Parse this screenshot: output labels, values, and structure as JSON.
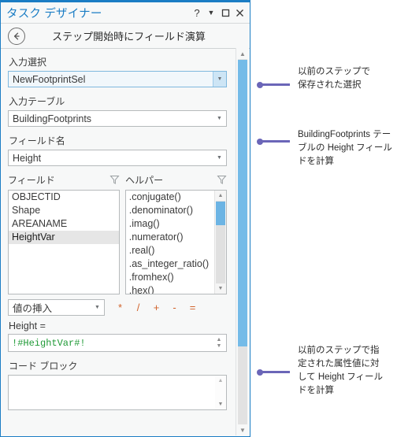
{
  "window": {
    "title": "タスク デザイナー",
    "controls": {
      "help": "?",
      "menu_caret": "caret-down",
      "maximize": "maximize",
      "close": "close"
    }
  },
  "header": {
    "back_label": "back-arrow",
    "step_title": "ステップ開始時にフィールド演算"
  },
  "form": {
    "input_selection": {
      "label": "入力選択",
      "value": "NewFootprintSel"
    },
    "input_table": {
      "label": "入力テーブル",
      "value": "BuildingFootprints"
    },
    "field_name": {
      "label": "フィールド名",
      "value": "Height"
    }
  },
  "lists": {
    "fields": {
      "label": "フィールド",
      "filter_icon": "funnel-icon",
      "items": [
        "OBJECTID",
        "Shape",
        "AREANAME",
        "HeightVar"
      ],
      "selected": "HeightVar"
    },
    "helpers": {
      "label": "ヘルパー",
      "filter_icon": "funnel-icon",
      "items": [
        ".conjugate()",
        ".denominator()",
        ".imag()",
        ".numerator()",
        ".real()",
        ".as_integer_ratio()",
        ".fromhex()",
        ".hex()"
      ]
    }
  },
  "operators": {
    "insert_value": {
      "label": "値の挿入"
    },
    "buttons": [
      "*",
      "/",
      "+",
      "-",
      "="
    ]
  },
  "expression": {
    "label": "Height =",
    "value": "!#HeightVar#!"
  },
  "code_block": {
    "label": "コード ブロック",
    "value": ""
  },
  "annotations": [
    {
      "text": "以前のステップで\n保存された選択"
    },
    {
      "text": "BuildingFootprints テー\nブルの Height フィール\nドを計算"
    },
    {
      "text": "以前のステップで指\n定された属性値に対\nして Height フィール\nドを計算"
    }
  ],
  "colors": {
    "accent": "#1b7dc4",
    "leader": "#6b66b8",
    "operator": "#d1622a",
    "expression_text": "#1f9a36",
    "scrollbar_thumb": "#74bbe8"
  }
}
